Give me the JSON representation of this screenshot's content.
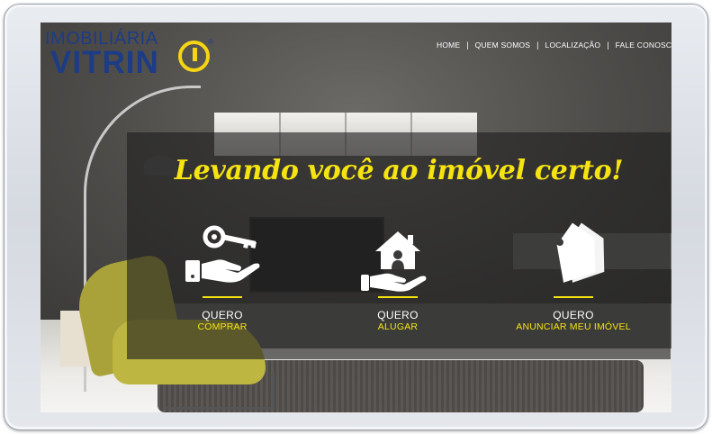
{
  "logo": {
    "top_text": "IMOBILIÁRIA",
    "main_text": "VITRIN",
    "registered": "®",
    "brand_blue": "#1d3c86",
    "brand_yellow": "#f6d512"
  },
  "nav": {
    "items": [
      {
        "label": "HOME"
      },
      {
        "label": "QUEM SOMOS"
      },
      {
        "label": "LOCALIZAÇÃO"
      },
      {
        "label": "FALE CONOSCO"
      }
    ],
    "separator": "|"
  },
  "hero": {
    "tagline": "Levando você ao imóvel certo!",
    "accent_color": "#f6e410"
  },
  "actions": [
    {
      "line1": "QUERO",
      "line2": "COMPRAR",
      "icon": "hand-with-key-icon"
    },
    {
      "line1": "QUERO",
      "line2": "ALUGAR",
      "icon": "hand-with-house-icon"
    },
    {
      "line1": "QUERO",
      "line2": "ANUNCIAR MEU IMÓVEL",
      "icon": "price-tags-icon"
    }
  ]
}
